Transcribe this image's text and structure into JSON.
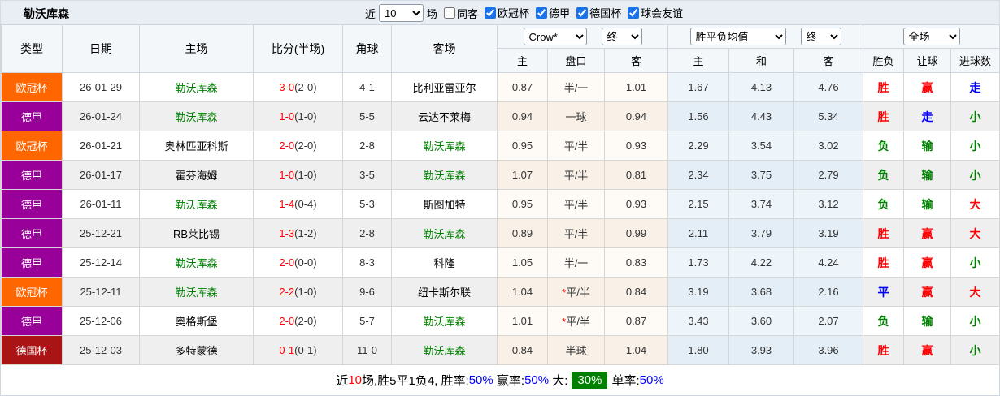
{
  "topbar": {
    "title": "勒沃库森",
    "recent_prefix": "近",
    "recent_value": "10",
    "recent_suffix": "场",
    "same_away": {
      "label": "同客",
      "checked": false
    },
    "filters": [
      {
        "label": "欧冠杯",
        "checked": true
      },
      {
        "label": "德甲",
        "checked": true
      },
      {
        "label": "德国杯",
        "checked": true
      },
      {
        "label": "球会友谊",
        "checked": true
      }
    ]
  },
  "table": {
    "main_headers": [
      "类型",
      "日期",
      "主场",
      "比分(半场)",
      "角球",
      "客场"
    ],
    "selects": {
      "odds_company": "Crow*",
      "odds_final": "终",
      "mean_label": "胜平负均值",
      "mean_final": "终",
      "scope": "全场"
    },
    "sub_headers": [
      "主",
      "盘口",
      "客",
      "主",
      "和",
      "客",
      "胜负",
      "让球",
      "进球数"
    ],
    "rows": [
      {
        "type": "欧冠杯",
        "type_key": "champions",
        "date": "26-01-29",
        "home": "勒沃库森",
        "home_team": true,
        "score": "3-0",
        "half": "(2-0)",
        "corner": "4-1",
        "away": "比利亚雷亚尔",
        "away_team": false,
        "odds_home": "0.87",
        "handicap": "半/一",
        "handicap_star": false,
        "odds_away": "1.01",
        "mean_home": "1.67",
        "mean_draw": "4.13",
        "mean_away": "4.76",
        "result": "胜",
        "result_color": "red",
        "handicap_result": "赢",
        "handicap_color": "red",
        "goals": "走",
        "goals_color": "blue"
      },
      {
        "type": "德甲",
        "type_key": "bundesliga",
        "date": "26-01-24",
        "home": "勒沃库森",
        "home_team": true,
        "score": "1-0",
        "half": "(1-0)",
        "corner": "5-5",
        "away": "云达不莱梅",
        "away_team": false,
        "odds_home": "0.94",
        "handicap": "一球",
        "handicap_star": false,
        "odds_away": "0.94",
        "mean_home": "1.56",
        "mean_draw": "4.43",
        "mean_away": "5.34",
        "result": "胜",
        "result_color": "red",
        "handicap_result": "走",
        "handicap_color": "blue",
        "goals": "小",
        "goals_color": "green"
      },
      {
        "type": "欧冠杯",
        "type_key": "champions",
        "date": "26-01-21",
        "home": "奥林匹亚科斯",
        "home_team": false,
        "score": "2-0",
        "half": "(2-0)",
        "corner": "2-8",
        "away": "勒沃库森",
        "away_team": true,
        "odds_home": "0.95",
        "handicap": "平/半",
        "handicap_star": false,
        "odds_away": "0.93",
        "mean_home": "2.29",
        "mean_draw": "3.54",
        "mean_away": "3.02",
        "result": "负",
        "result_color": "green",
        "handicap_result": "输",
        "handicap_color": "green",
        "goals": "小",
        "goals_color": "green"
      },
      {
        "type": "德甲",
        "type_key": "bundesliga",
        "date": "26-01-17",
        "home": "霍芬海姆",
        "home_team": false,
        "score": "1-0",
        "half": "(1-0)",
        "corner": "3-5",
        "away": "勒沃库森",
        "away_team": true,
        "odds_home": "1.07",
        "handicap": "平/半",
        "handicap_star": false,
        "odds_away": "0.81",
        "mean_home": "2.34",
        "mean_draw": "3.75",
        "mean_away": "2.79",
        "result": "负",
        "result_color": "green",
        "handicap_result": "输",
        "handicap_color": "green",
        "goals": "小",
        "goals_color": "green"
      },
      {
        "type": "德甲",
        "type_key": "bundesliga",
        "date": "26-01-11",
        "home": "勒沃库森",
        "home_team": true,
        "score": "1-4",
        "half": "(0-4)",
        "corner": "5-3",
        "away": "斯图加特",
        "away_team": false,
        "odds_home": "0.95",
        "handicap": "平/半",
        "handicap_star": false,
        "odds_away": "0.93",
        "mean_home": "2.15",
        "mean_draw": "3.74",
        "mean_away": "3.12",
        "result": "负",
        "result_color": "green",
        "handicap_result": "输",
        "handicap_color": "green",
        "goals": "大",
        "goals_color": "red"
      },
      {
        "type": "德甲",
        "type_key": "bundesliga",
        "date": "25-12-21",
        "home": "RB莱比锡",
        "home_team": false,
        "score": "1-3",
        "half": "(1-2)",
        "corner": "2-8",
        "away": "勒沃库森",
        "away_team": true,
        "odds_home": "0.89",
        "handicap": "平/半",
        "handicap_star": false,
        "odds_away": "0.99",
        "mean_home": "2.11",
        "mean_draw": "3.79",
        "mean_away": "3.19",
        "result": "胜",
        "result_color": "red",
        "handicap_result": "赢",
        "handicap_color": "red",
        "goals": "大",
        "goals_color": "red"
      },
      {
        "type": "德甲",
        "type_key": "bundesliga",
        "date": "25-12-14",
        "home": "勒沃库森",
        "home_team": true,
        "score": "2-0",
        "half": "(0-0)",
        "corner": "8-3",
        "away": "科隆",
        "away_team": false,
        "odds_home": "1.05",
        "handicap": "半/一",
        "handicap_star": false,
        "odds_away": "0.83",
        "mean_home": "1.73",
        "mean_draw": "4.22",
        "mean_away": "4.24",
        "result": "胜",
        "result_color": "red",
        "handicap_result": "赢",
        "handicap_color": "red",
        "goals": "小",
        "goals_color": "green"
      },
      {
        "type": "欧冠杯",
        "type_key": "champions",
        "date": "25-12-11",
        "home": "勒沃库森",
        "home_team": true,
        "score": "2-2",
        "half": "(1-0)",
        "corner": "9-6",
        "away": "纽卡斯尔联",
        "away_team": false,
        "odds_home": "1.04",
        "handicap": "平/半",
        "handicap_star": true,
        "odds_away": "0.84",
        "mean_home": "3.19",
        "mean_draw": "3.68",
        "mean_away": "2.16",
        "result": "平",
        "result_color": "blue",
        "handicap_result": "赢",
        "handicap_color": "red",
        "goals": "大",
        "goals_color": "red"
      },
      {
        "type": "德甲",
        "type_key": "bundesliga",
        "date": "25-12-06",
        "home": "奥格斯堡",
        "home_team": false,
        "score": "2-0",
        "half": "(2-0)",
        "corner": "5-7",
        "away": "勒沃库森",
        "away_team": true,
        "odds_home": "1.01",
        "handicap": "平/半",
        "handicap_star": true,
        "odds_away": "0.87",
        "mean_home": "3.43",
        "mean_draw": "3.60",
        "mean_away": "2.07",
        "result": "负",
        "result_color": "green",
        "handicap_result": "输",
        "handicap_color": "green",
        "goals": "小",
        "goals_color": "green"
      },
      {
        "type": "德国杯",
        "type_key": "dfb_pokal",
        "date": "25-12-03",
        "home": "多特蒙德",
        "home_team": false,
        "score": "0-1",
        "half": "(0-1)",
        "corner": "11-0",
        "away": "勒沃库森",
        "away_team": true,
        "odds_home": "0.84",
        "handicap": "半球",
        "handicap_star": false,
        "odds_away": "1.04",
        "mean_home": "1.80",
        "mean_draw": "3.93",
        "mean_away": "3.96",
        "result": "胜",
        "result_color": "red",
        "handicap_result": "赢",
        "handicap_color": "red",
        "goals": "小",
        "goals_color": "green"
      }
    ]
  },
  "footer": {
    "prefix": "近",
    "count": "10",
    "middle": "场,胜5平1负4, 胜率:",
    "win_rate": "50%",
    "earn_label": " 赢率:",
    "earn_value": "50%",
    "big_label": " 大:",
    "big_value": "30%",
    "single_label": "单率:",
    "single_value": "50%"
  },
  "colors": {
    "champions": "#ff6600",
    "bundesliga": "#990099",
    "dfb_pokal": "#aa1414",
    "team_green": "#008000",
    "score_red": "#ff0000",
    "badge_green_bg": "#008000"
  }
}
